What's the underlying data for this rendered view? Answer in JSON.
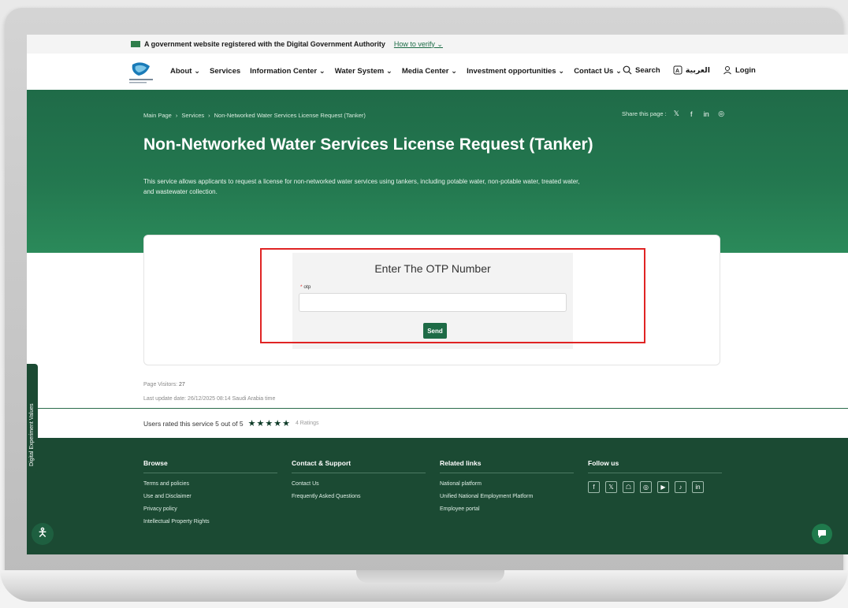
{
  "gov_bar": {
    "text": "A government website registered with the Digital Government Authority",
    "link": "How to verify"
  },
  "nav": {
    "items": [
      {
        "label": "About"
      },
      {
        "label": "Services"
      },
      {
        "label": "Information Center"
      },
      {
        "label": "Water System"
      },
      {
        "label": "Media Center"
      },
      {
        "label": "Investment opportunities"
      },
      {
        "label": "Contact Us"
      }
    ],
    "search": "Search",
    "language": "العربية",
    "login": "Login"
  },
  "hero": {
    "breadcrumb": [
      "Main Page",
      "Services",
      "Non-Networked Water Services License Request (Tanker)"
    ],
    "share_label": "Share this page :",
    "title": "Non-Networked Water Services License Request (Tanker)",
    "description": "This service allows applicants to request a license for non-networked water services using tankers, including potable water, non-potable water, treated water, and wastewater collection."
  },
  "otp_form": {
    "title": "Enter The OTP Number",
    "field_label": "otp",
    "field_value": "",
    "send_label": "Send"
  },
  "meta": {
    "visitors_label": "Page Visitors:",
    "visitors": "27",
    "last_update": "Last update date: 26/12/2025 08:14 Saudi Arabia time"
  },
  "rating": {
    "text": "Users rated this service 5 out of 5",
    "stars": "★★★★★",
    "count": "4 Ratings"
  },
  "footer": {
    "browse": {
      "title": "Browse",
      "links": [
        "Terms and policies",
        "Use and Disclaimer",
        "Privacy policy",
        "Intellectual Property Rights"
      ]
    },
    "contact": {
      "title": "Contact & Support",
      "links": [
        "Contact Us",
        "Frequently Asked Questions"
      ]
    },
    "related": {
      "title": "Related links",
      "links": [
        "National platform",
        "Unified National Employment Platform",
        "Employee portal"
      ]
    },
    "follow": {
      "title": "Follow us"
    }
  },
  "side_tab": "Digital Experiment Values",
  "colors": {
    "brand_green": "#1e6b46",
    "footer_green": "#1b4a33",
    "highlight_red": "#e02424"
  }
}
